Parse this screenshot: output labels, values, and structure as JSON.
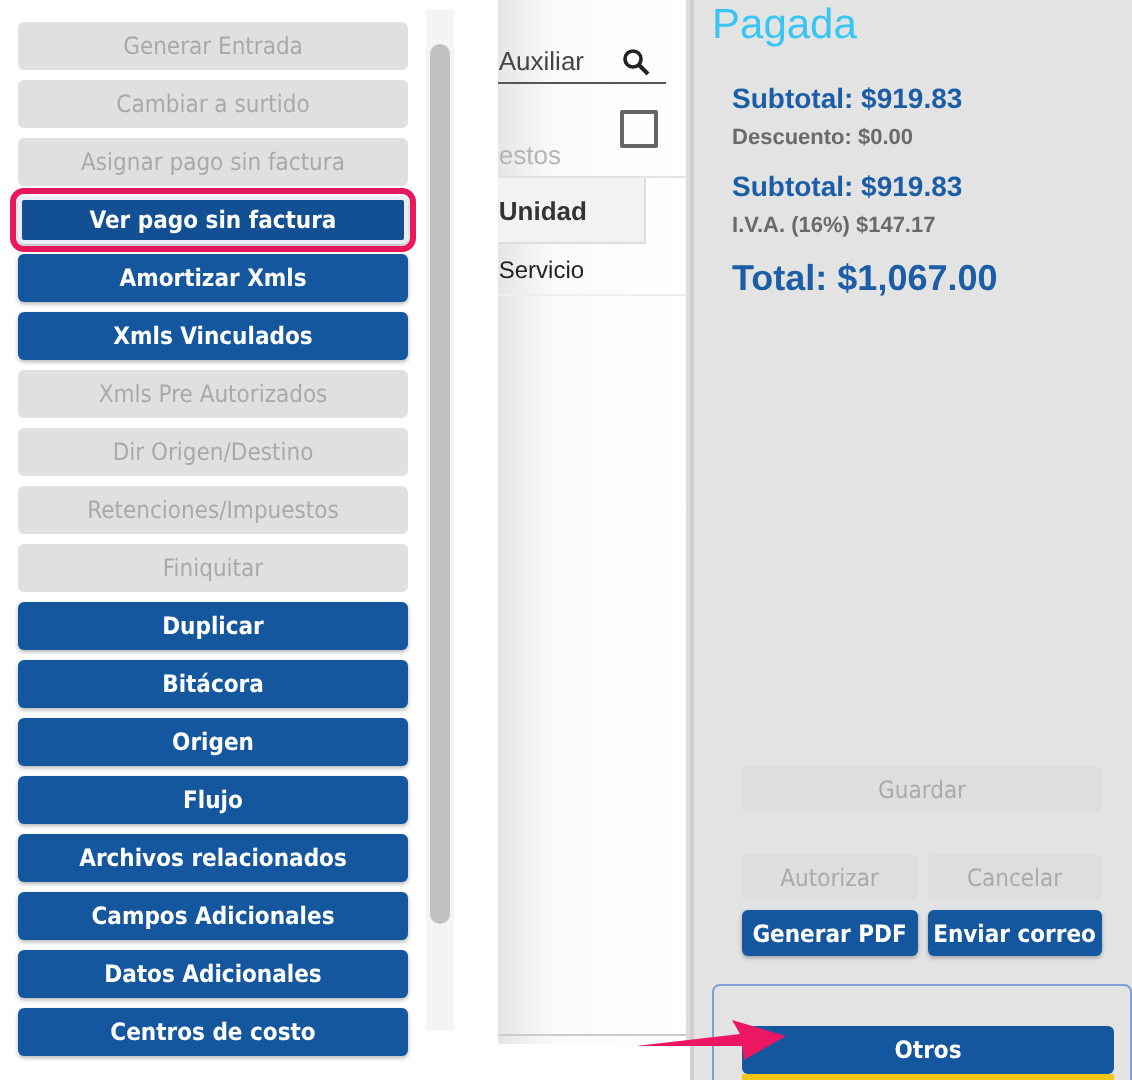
{
  "menu": {
    "buttons": [
      {
        "label": "Generar Entrada",
        "disabled": true,
        "highlighted": false
      },
      {
        "label": "Cambiar a surtido",
        "disabled": true,
        "highlighted": false
      },
      {
        "label": "Asignar pago sin factura",
        "disabled": true,
        "highlighted": false
      },
      {
        "label": "Ver pago sin factura",
        "disabled": false,
        "highlighted": true
      },
      {
        "label": "Amortizar Xmls",
        "disabled": false,
        "highlighted": false
      },
      {
        "label": "Xmls Vinculados",
        "disabled": false,
        "highlighted": false
      },
      {
        "label": "Xmls Pre Autorizados",
        "disabled": true,
        "highlighted": false
      },
      {
        "label": "Dir Origen/Destino",
        "disabled": true,
        "highlighted": false
      },
      {
        "label": "Retenciones/Impuestos",
        "disabled": true,
        "highlighted": false
      },
      {
        "label": "Finiquitar",
        "disabled": true,
        "highlighted": false
      },
      {
        "label": "Duplicar",
        "disabled": false,
        "highlighted": false
      },
      {
        "label": "Bitácora",
        "disabled": false,
        "highlighted": false
      },
      {
        "label": "Origen",
        "disabled": false,
        "highlighted": false
      },
      {
        "label": "Flujo",
        "disabled": false,
        "highlighted": false
      },
      {
        "label": "Archivos relacionados",
        "disabled": false,
        "highlighted": false
      },
      {
        "label": "Campos Adicionales",
        "disabled": false,
        "highlighted": false
      },
      {
        "label": "Datos Adicionales",
        "disabled": false,
        "highlighted": false
      },
      {
        "label": "Centros de costo",
        "disabled": false,
        "highlighted": false
      }
    ]
  },
  "detail": {
    "search": {
      "value": "Auxiliar"
    },
    "section_label": "estos",
    "select_all": {
      "checked": false
    },
    "table": {
      "columns": [
        "Unidad"
      ],
      "rows": [
        [
          "Servicio"
        ]
      ]
    }
  },
  "summary": {
    "status": "Pagada",
    "lines": [
      {
        "kind": "major",
        "text": "Subtotal: $919.83"
      },
      {
        "kind": "minor",
        "text": "Descuento: $0.00"
      },
      {
        "kind": "major",
        "text": "Subtotal: $919.83"
      },
      {
        "kind": "minor",
        "text": "I.V.A. (16%) $147.17"
      },
      {
        "kind": "total",
        "text": "Total: $1,067.00"
      }
    ],
    "actions": [
      [
        {
          "label": "Guardar",
          "disabled": true
        }
      ],
      [
        {
          "label": "Autorizar",
          "disabled": true
        },
        {
          "label": "Cancelar",
          "disabled": true
        }
      ],
      [
        {
          "label": "Generar PDF",
          "disabled": false
        },
        {
          "label": "Enviar correo",
          "disabled": false
        }
      ]
    ],
    "other": {
      "label": "Otros",
      "pointed": true
    }
  }
}
